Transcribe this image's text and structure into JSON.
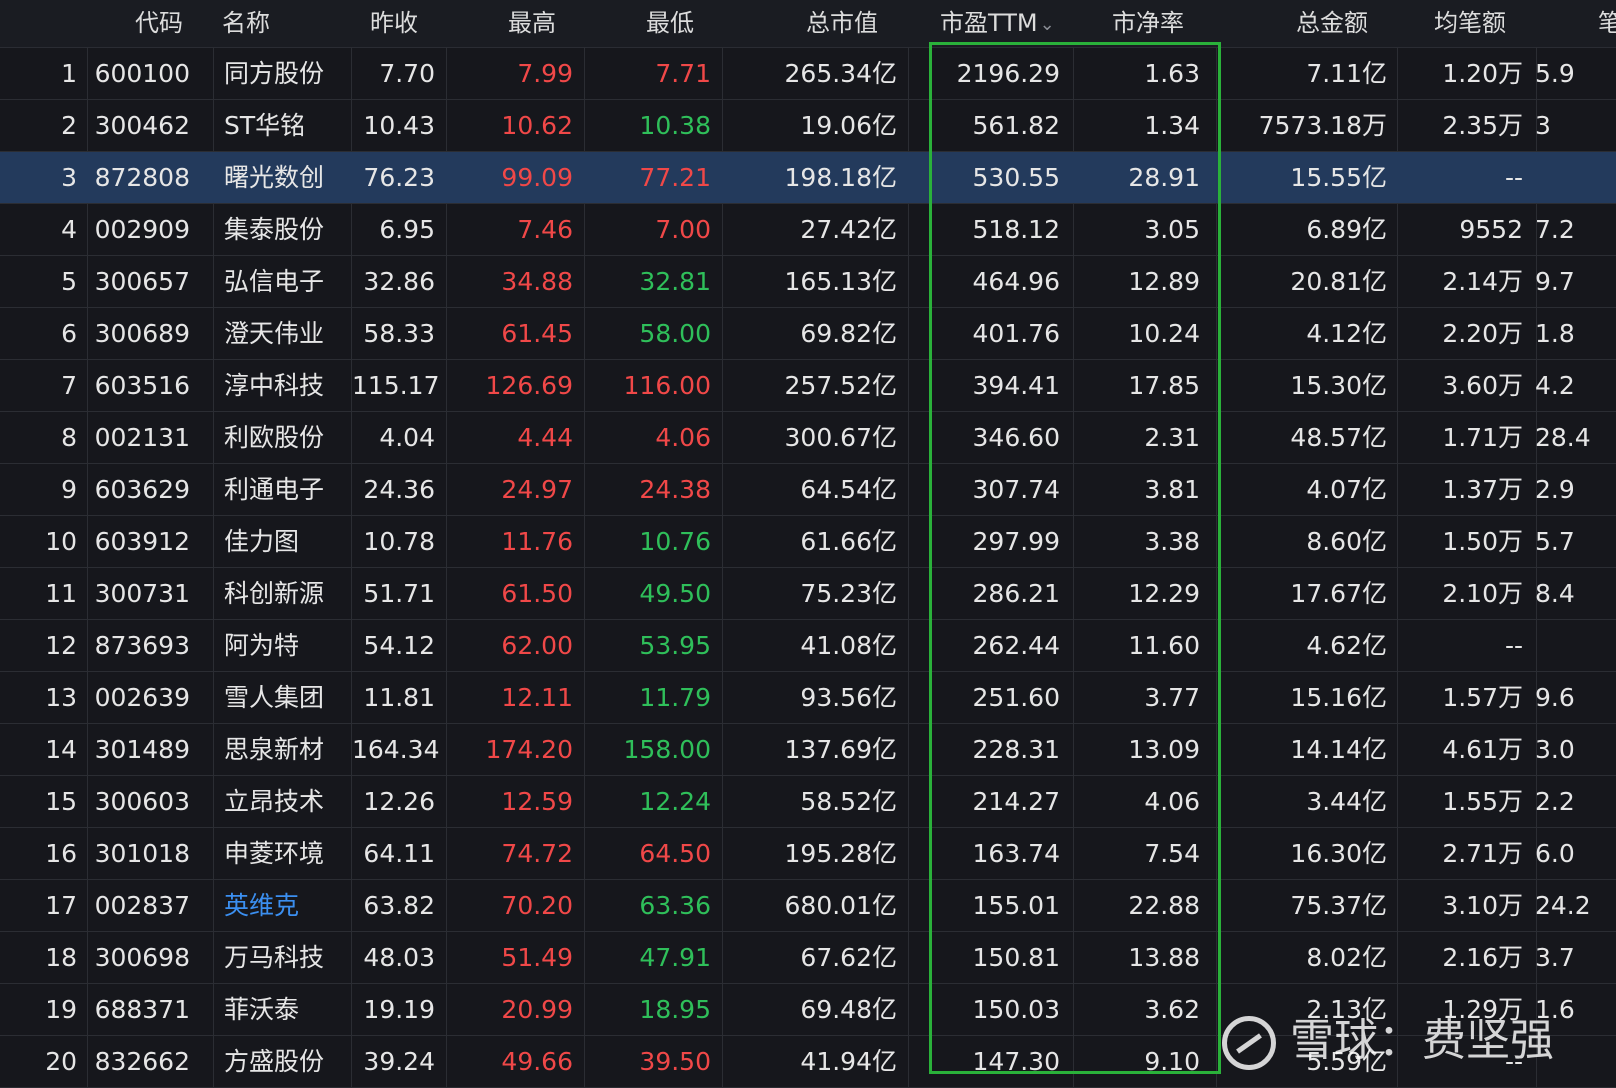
{
  "table": {
    "columns": [
      "",
      "代码",
      "名称",
      "昨收",
      "最高",
      "最低",
      "总市值",
      "市盈TTM",
      "市净率",
      "总金额",
      "均笔额",
      "笔"
    ],
    "sort_icon": "chevron-down-icon",
    "selected_row": 3,
    "rows": [
      {
        "n": "1",
        "code": "600100",
        "name": "同方股份",
        "prev": "7.70",
        "high": "7.99",
        "high_c": "red",
        "low": "7.71",
        "low_c": "red",
        "cap": "265.34亿",
        "pe": "2196.29",
        "pb": "1.63",
        "amt": "7.11亿",
        "avg": "1.20万",
        "cnt": "5.9"
      },
      {
        "n": "2",
        "code": "300462",
        "name": "ST华铭",
        "prev": "10.43",
        "high": "10.62",
        "high_c": "red",
        "low": "10.38",
        "low_c": "green",
        "cap": "19.06亿",
        "pe": "561.82",
        "pb": "1.34",
        "amt": "7573.18万",
        "avg": "2.35万",
        "cnt": "3"
      },
      {
        "n": "3",
        "code": "872808",
        "name": "曙光数创",
        "prev": "76.23",
        "high": "99.09",
        "high_c": "red",
        "low": "77.21",
        "low_c": "red",
        "cap": "198.18亿",
        "pe": "530.55",
        "pb": "28.91",
        "amt": "15.55亿",
        "avg": "--",
        "cnt": ""
      },
      {
        "n": "4",
        "code": "002909",
        "name": "集泰股份",
        "prev": "6.95",
        "high": "7.46",
        "high_c": "red",
        "low": "7.00",
        "low_c": "red",
        "cap": "27.42亿",
        "pe": "518.12",
        "pb": "3.05",
        "amt": "6.89亿",
        "avg": "9552",
        "cnt": "7.2"
      },
      {
        "n": "5",
        "code": "300657",
        "name": "弘信电子",
        "prev": "32.86",
        "high": "34.88",
        "high_c": "red",
        "low": "32.81",
        "low_c": "green",
        "cap": "165.13亿",
        "pe": "464.96",
        "pb": "12.89",
        "amt": "20.81亿",
        "avg": "2.14万",
        "cnt": "9.7"
      },
      {
        "n": "6",
        "code": "300689",
        "name": "澄天伟业",
        "prev": "58.33",
        "high": "61.45",
        "high_c": "red",
        "low": "58.00",
        "low_c": "green",
        "cap": "69.82亿",
        "pe": "401.76",
        "pb": "10.24",
        "amt": "4.12亿",
        "avg": "2.20万",
        "cnt": "1.8"
      },
      {
        "n": "7",
        "code": "603516",
        "name": "淳中科技",
        "prev": "115.17",
        "high": "126.69",
        "high_c": "red",
        "low": "116.00",
        "low_c": "red",
        "cap": "257.52亿",
        "pe": "394.41",
        "pb": "17.85",
        "amt": "15.30亿",
        "avg": "3.60万",
        "cnt": "4.2"
      },
      {
        "n": "8",
        "code": "002131",
        "name": "利欧股份",
        "prev": "4.04",
        "high": "4.44",
        "high_c": "red",
        "low": "4.06",
        "low_c": "red",
        "cap": "300.67亿",
        "pe": "346.60",
        "pb": "2.31",
        "amt": "48.57亿",
        "avg": "1.71万",
        "cnt": "28.4"
      },
      {
        "n": "9",
        "code": "603629",
        "name": "利通电子",
        "prev": "24.36",
        "high": "24.97",
        "high_c": "red",
        "low": "24.38",
        "low_c": "red",
        "cap": "64.54亿",
        "pe": "307.74",
        "pb": "3.81",
        "amt": "4.07亿",
        "avg": "1.37万",
        "cnt": "2.9"
      },
      {
        "n": "10",
        "code": "603912",
        "name": "佳力图",
        "prev": "10.78",
        "high": "11.76",
        "high_c": "red",
        "low": "10.76",
        "low_c": "green",
        "cap": "61.66亿",
        "pe": "297.99",
        "pb": "3.38",
        "amt": "8.60亿",
        "avg": "1.50万",
        "cnt": "5.7"
      },
      {
        "n": "11",
        "code": "300731",
        "name": "科创新源",
        "prev": "51.71",
        "high": "61.50",
        "high_c": "red",
        "low": "49.50",
        "low_c": "green",
        "cap": "75.23亿",
        "pe": "286.21",
        "pb": "12.29",
        "amt": "17.67亿",
        "avg": "2.10万",
        "cnt": "8.4"
      },
      {
        "n": "12",
        "code": "873693",
        "name": "阿为特",
        "prev": "54.12",
        "high": "62.00",
        "high_c": "red",
        "low": "53.95",
        "low_c": "green",
        "cap": "41.08亿",
        "pe": "262.44",
        "pb": "11.60",
        "amt": "4.62亿",
        "avg": "--",
        "cnt": ""
      },
      {
        "n": "13",
        "code": "002639",
        "name": "雪人集团",
        "prev": "11.81",
        "high": "12.11",
        "high_c": "red",
        "low": "11.79",
        "low_c": "green",
        "cap": "93.56亿",
        "pe": "251.60",
        "pb": "3.77",
        "amt": "15.16亿",
        "avg": "1.57万",
        "cnt": "9.6"
      },
      {
        "n": "14",
        "code": "301489",
        "name": "思泉新材",
        "prev": "164.34",
        "high": "174.20",
        "high_c": "red",
        "low": "158.00",
        "low_c": "green",
        "cap": "137.69亿",
        "pe": "228.31",
        "pb": "13.09",
        "amt": "14.14亿",
        "avg": "4.61万",
        "cnt": "3.0"
      },
      {
        "n": "15",
        "code": "300603",
        "name": "立昂技术",
        "prev": "12.26",
        "high": "12.59",
        "high_c": "red",
        "low": "12.24",
        "low_c": "green",
        "cap": "58.52亿",
        "pe": "214.27",
        "pb": "4.06",
        "amt": "3.44亿",
        "avg": "1.55万",
        "cnt": "2.2"
      },
      {
        "n": "16",
        "code": "301018",
        "name": "申菱环境",
        "prev": "64.11",
        "high": "74.72",
        "high_c": "red",
        "low": "64.50",
        "low_c": "red",
        "cap": "195.28亿",
        "pe": "163.74",
        "pb": "7.54",
        "amt": "16.30亿",
        "avg": "2.71万",
        "cnt": "6.0"
      },
      {
        "n": "17",
        "code": "002837",
        "name": "英维克",
        "name_c": "blue",
        "prev": "63.82",
        "high": "70.20",
        "high_c": "red",
        "low": "63.36",
        "low_c": "green",
        "cap": "680.01亿",
        "pe": "155.01",
        "pb": "22.88",
        "amt": "75.37亿",
        "avg": "3.10万",
        "cnt": "24.2"
      },
      {
        "n": "18",
        "code": "300698",
        "name": "万马科技",
        "prev": "48.03",
        "high": "51.49",
        "high_c": "red",
        "low": "47.91",
        "low_c": "green",
        "cap": "67.62亿",
        "pe": "150.81",
        "pb": "13.88",
        "amt": "8.02亿",
        "avg": "2.16万",
        "cnt": "3.7"
      },
      {
        "n": "19",
        "code": "688371",
        "name": "菲沃泰",
        "prev": "19.19",
        "high": "20.99",
        "high_c": "red",
        "low": "18.95",
        "low_c": "green",
        "cap": "69.48亿",
        "pe": "150.03",
        "pb": "3.62",
        "amt": "2.13亿",
        "avg": "1.29万",
        "cnt": "1.6"
      },
      {
        "n": "20",
        "code": "832662",
        "name": "方盛股份",
        "prev": "39.24",
        "high": "49.66",
        "high_c": "red",
        "low": "39.50",
        "low_c": "red",
        "cap": "41.94亿",
        "pe": "147.30",
        "pb": "9.10",
        "amt": "5.59亿",
        "avg": "--",
        "cnt": ""
      }
    ]
  },
  "watermark": {
    "text": "雪球：费坚强",
    "icon": "snowball-logo-icon"
  },
  "colors": {
    "up": "#f04848",
    "down": "#2fbf5a",
    "link": "#3b8ff0",
    "highlight": "#2ab13a",
    "selected": "#233a5c"
  }
}
